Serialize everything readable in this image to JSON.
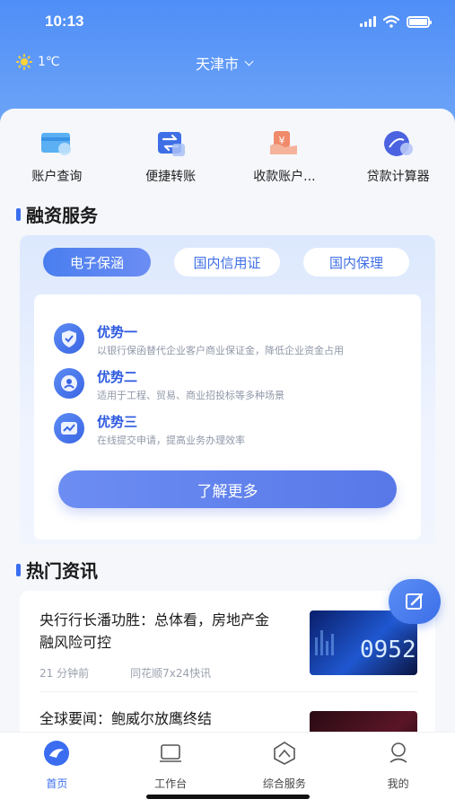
{
  "status_bar": {
    "time": "10:13"
  },
  "header": {
    "temperature": "1℃",
    "city": "天津市",
    "weather_icon": "sun-icon"
  },
  "quick_actions": [
    {
      "label": "账户查询",
      "icon": "account-card-icon"
    },
    {
      "label": "便捷转账",
      "icon": "transfer-icon"
    },
    {
      "label": "收款账户...",
      "icon": "receive-account-icon"
    },
    {
      "label": "贷款计算器",
      "icon": "loan-calculator-icon"
    }
  ],
  "finance": {
    "title": "融资服务",
    "tabs": [
      {
        "label": "电子保涵",
        "active": true
      },
      {
        "label": "国内信用证",
        "active": false
      },
      {
        "label": "国内保理",
        "active": false
      }
    ],
    "advantages": [
      {
        "title": "优势一",
        "desc": "以银行保函替代企业客户商业保证金，降低企业资金占用",
        "icon": "shield-check-icon"
      },
      {
        "title": "优势二",
        "desc": "适用于工程、贸易、商业招投标等多种场景",
        "icon": "people-icon"
      },
      {
        "title": "优势三",
        "desc": "在线提交申请，提高业务办理效率",
        "icon": "trend-up-icon"
      }
    ],
    "cta": "了解更多"
  },
  "news": {
    "title": "热门资讯",
    "items": [
      {
        "title": "央行行长潘功胜：总体看，房地产金融风险可控",
        "time": "21 分钟前",
        "source": "同花顺7x24快讯",
        "thumb_text": "0952"
      },
      {
        "title": "全球要闻：鲍威尔放鹰终结"
      }
    ]
  },
  "tabbar": [
    {
      "label": "首页",
      "icon": "home-icon",
      "active": true
    },
    {
      "label": "工作台",
      "icon": "workbench-icon",
      "active": false
    },
    {
      "label": "综合服务",
      "icon": "services-icon",
      "active": false
    },
    {
      "label": "我的",
      "icon": "profile-icon",
      "active": false
    }
  ],
  "colors": {
    "primary": "#3a6df0",
    "header_bg": "#4f8ef7"
  }
}
